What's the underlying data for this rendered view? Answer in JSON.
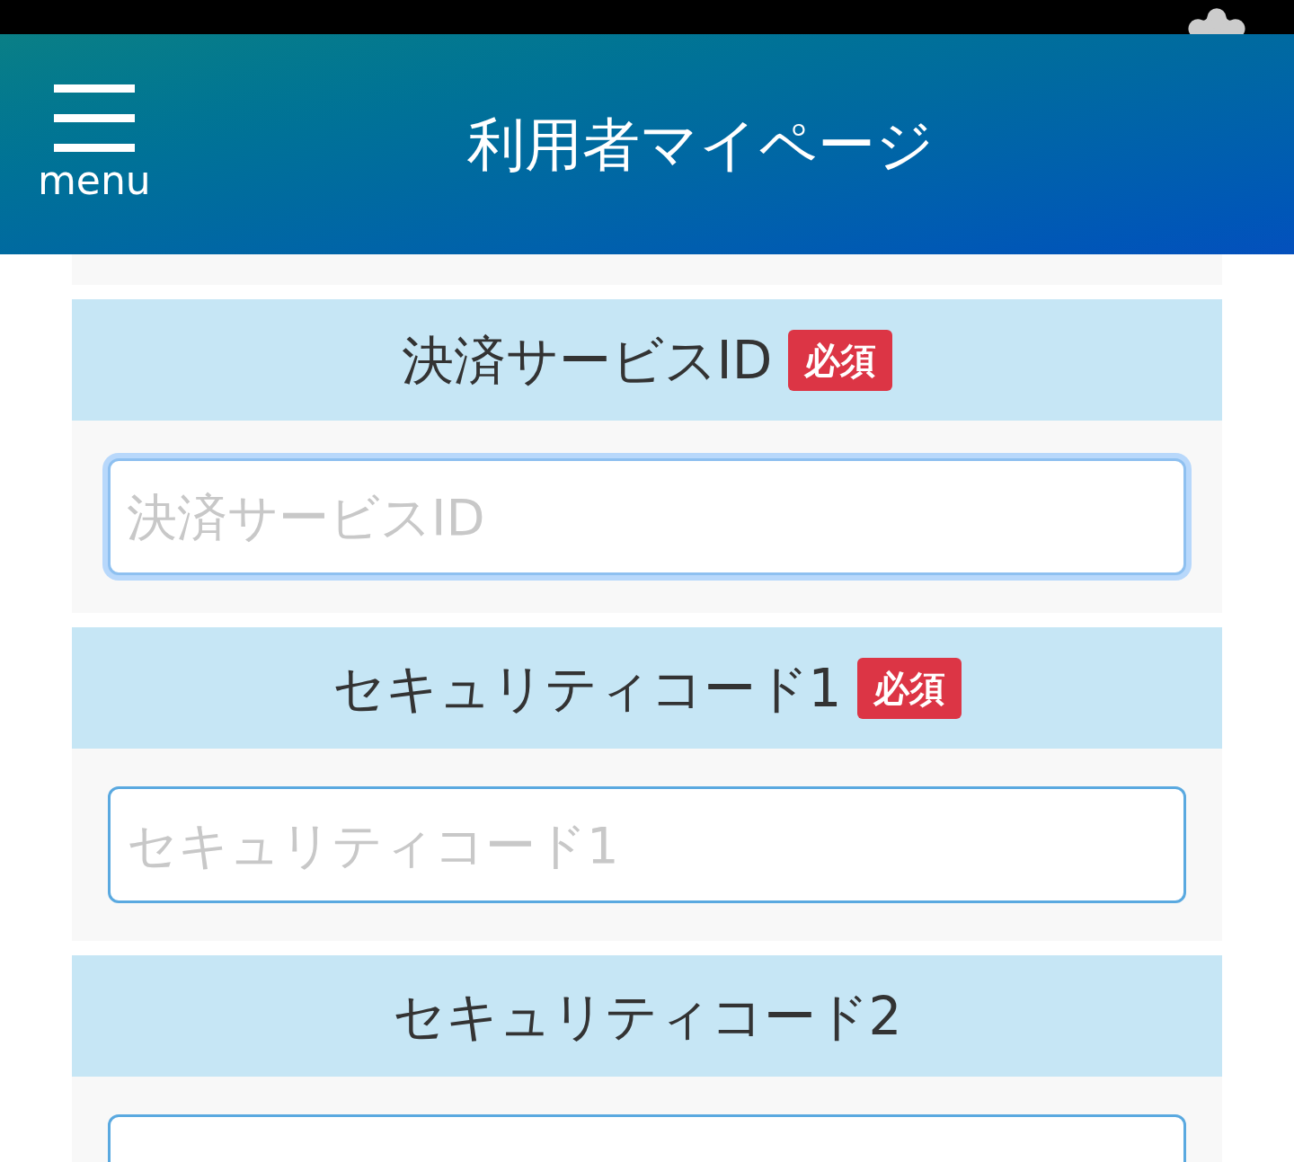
{
  "header": {
    "menu_label": "menu",
    "title": "利用者マイページ"
  },
  "fields": [
    {
      "label": "決済サービスID",
      "badge": "必須",
      "placeholder": "決済サービスID",
      "focused": true
    },
    {
      "label": "セキュリティコード1",
      "badge": "必須",
      "placeholder": "セキュリティコード1",
      "focused": false
    },
    {
      "label": "セキュリティコード2",
      "focused": false
    }
  ]
}
